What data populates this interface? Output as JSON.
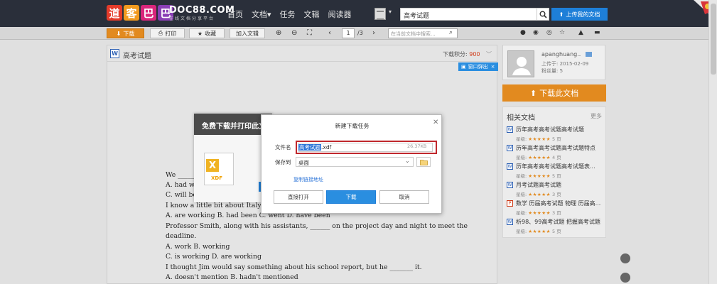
{
  "header": {
    "logo_chars": [
      "道",
      "客",
      "巴",
      "巴"
    ],
    "logo_text": "DOC88.COM",
    "logo_sub": "在线文档分享平台",
    "nav": [
      "首页",
      "文档▾",
      "任务",
      "文辑",
      "阅读器"
    ],
    "search_value": "高考试题",
    "upload_label": "上传我的文档"
  },
  "toolbar": {
    "download": "下载",
    "print": "打印",
    "favorite": "收藏",
    "add_collection": "加入文辑",
    "page_current": "1",
    "page_total": "/3",
    "search_placeholder": "在当前文档中搜索..."
  },
  "document": {
    "title": "高考试题",
    "score_label": "下载积分:",
    "score_value": "900",
    "popout_label": "窗口弹出",
    "lines": [
      "We ______",
      "A. had wo",
      "C. will be",
      "I know a little bit about Italy as my",
      "A. are working     B. had been     C. went     D. have been",
      "Professor Smith, along with his assistants, ______ on the project day and night to meet the",
      "deadline.",
      "A. work                                    B. working",
      "C. is working                            D. are working",
      "I thought Jim would say something about his school report, but he _______ it.",
      "A. doesn't mention                   B. hadn't mentioned"
    ]
  },
  "bg_modal": {
    "title": "免费下载并打印此文",
    "file_type": "XDF"
  },
  "dialog": {
    "title": "新建下载任务",
    "filename_label": "文件名",
    "filename_selected": "高考试题",
    "filename_ext": ".xdf",
    "filesize": "26.37KB",
    "saveto_label": "保存到",
    "saveto_value": "桌面",
    "copy_link": "复制链接地址",
    "open_btn": "直接打开",
    "download_btn": "下载",
    "cancel_btn": "取消"
  },
  "user": {
    "name": "apanghuang..",
    "uploaded": "上传于: 2015-02-09",
    "fans": "粉丝量: 5"
  },
  "download_main": "下载此文档",
  "related": {
    "title": "相关文档",
    "more": "更多",
    "items": [
      {
        "title": "历年高考高考试题高考试题",
        "pages": "5 页",
        "icon": "W"
      },
      {
        "title": "历年高考高考试题高考试题特点",
        "pages": "4 页",
        "icon": "W"
      },
      {
        "title": "历年高考高考试题高考试题表...",
        "pages": "5 页",
        "icon": "W"
      },
      {
        "title": "月考试题高考试题",
        "pages": "3 页",
        "icon": "W"
      },
      {
        "title": "数学 历届高考试题 物理 历届高...",
        "pages": "3 页",
        "icon": "P"
      },
      {
        "title": "析98、99高考试题 把握高考试题",
        "pages": "5 页",
        "icon": "W"
      }
    ],
    "rating_label": "星级:",
    "stars": "★★★★★"
  },
  "colors": {
    "brand_orange": "#e28a1f",
    "accent_blue": "#2a8ee0",
    "highlight_red": "#c0282d"
  }
}
